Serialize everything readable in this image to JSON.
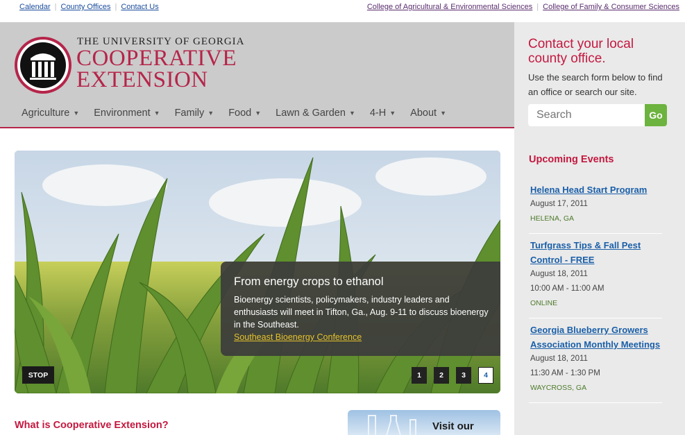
{
  "topbar": {
    "left_links": [
      "Calendar",
      "County Offices",
      "Contact Us"
    ],
    "right_links": [
      "College of Agricultural & Environmental Sciences",
      "College of Family & Consumer Sciences"
    ]
  },
  "logo": {
    "top_line": "THE UNIVERSITY OF GEORGIA",
    "line1": "COOPERATIVE",
    "line2": "EXTENSION"
  },
  "nav": {
    "items": [
      "Agriculture",
      "Environment",
      "Family",
      "Food",
      "Lawn & Garden",
      "4-H",
      "About"
    ]
  },
  "hero": {
    "title": "From energy crops to ethanol",
    "text": "Bioenergy scientists, policymakers, industry leaders and enthusiasts will meet in Tifton, Ga., Aug. 9-11 to discuss bioenergy in the Southeast.",
    "link": "Southeast Bioenergy Conference",
    "stop_label": "STOP",
    "pages": [
      "1",
      "2",
      "3",
      "4"
    ],
    "active_page": "4"
  },
  "main": {
    "what_title": "What is Cooperative Extension?",
    "visit_text": "Visit our"
  },
  "sidebar": {
    "contact_title": "Contact your local county office.",
    "contact_desc": "Use the search form below to find an office or search our site.",
    "search_placeholder": "Search",
    "go_label": "Go",
    "events_title": "Upcoming Events",
    "events": [
      {
        "title": "Helena Head Start Program",
        "date": "August 17, 2011",
        "time": "",
        "location": "HELENA, GA"
      },
      {
        "title": "Turfgrass Tips & Fall Pest Control - FREE",
        "date": "August 18, 2011",
        "time": "10:00 AM - 11:00 AM",
        "location": "ONLINE"
      },
      {
        "title": "Georgia Blueberry Growers Association Monthly Meetings",
        "date": "August 18, 2011",
        "time": "11:30 AM - 1:30 PM",
        "location": "WAYCROSS, GA"
      }
    ]
  },
  "colors": {
    "brand_red": "#b5254a",
    "link_blue": "#1a5fa8",
    "go_green": "#6db33f",
    "header_gray": "#cbcbcb",
    "sidebar_gray": "#eaeaea"
  }
}
